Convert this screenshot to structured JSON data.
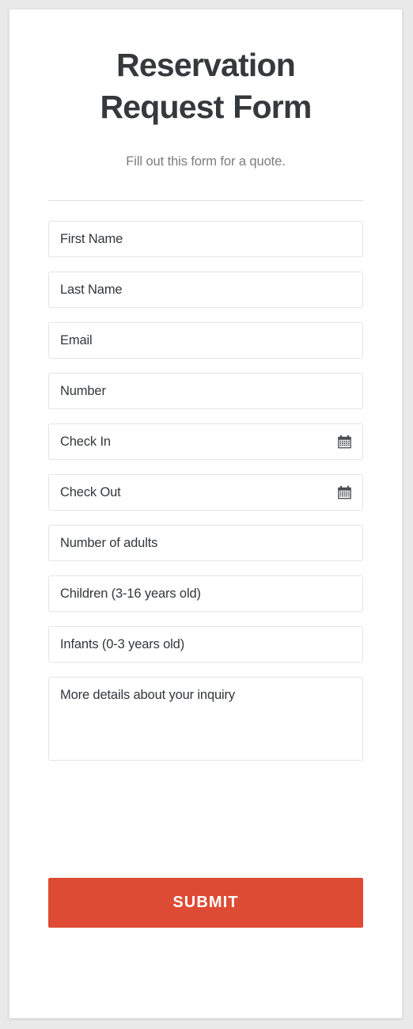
{
  "header": {
    "title_line1": "Reservation",
    "title_line2": "Request Form",
    "subtitle": "Fill out this form for a quote."
  },
  "form": {
    "fields": [
      {
        "label": "First Name",
        "type": "text",
        "icon": ""
      },
      {
        "label": "Last Name",
        "type": "text",
        "icon": ""
      },
      {
        "label": "Email",
        "type": "email",
        "icon": ""
      },
      {
        "label": "Number",
        "type": "tel",
        "icon": ""
      },
      {
        "label": "Check In",
        "type": "date",
        "icon": "calendar-icon"
      },
      {
        "label": "Check Out",
        "type": "date",
        "icon": "calendar-icon"
      },
      {
        "label": "Number of adults",
        "type": "number",
        "icon": ""
      },
      {
        "label": "Children (3-16 years old)",
        "type": "number",
        "icon": ""
      },
      {
        "label": "Infants (0-3 years old)",
        "type": "number",
        "icon": ""
      }
    ],
    "textarea": {
      "label": "More details about your inquiry"
    }
  },
  "submit": {
    "label": "SUBMIT"
  },
  "colors": {
    "accent": "#dd4b34",
    "title_text": "#36393c",
    "subtitle_text": "#7c7c7c",
    "field_text": "#33373b",
    "field_border": "#e4e4e4",
    "divider": "#dededf",
    "card_background": "#ffffff",
    "page_background": "#e9e9e9",
    "submit_text": "#ffffff"
  }
}
